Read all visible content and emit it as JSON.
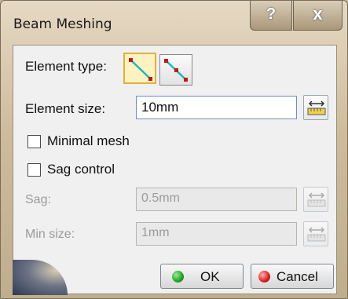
{
  "window": {
    "title": "Beam Meshing",
    "help_glyph": "?",
    "close_glyph": "x"
  },
  "element_type": {
    "label": "Element type:",
    "options": [
      {
        "icon": "linear-beam-element-icon",
        "selected": true
      },
      {
        "icon": "parabolic-beam-element-icon",
        "selected": false
      }
    ]
  },
  "element_size": {
    "label": "Element size:",
    "value": "10mm"
  },
  "minimal_mesh": {
    "label": "Minimal mesh",
    "checked": false
  },
  "sag_control": {
    "label": "Sag control",
    "checked": false
  },
  "sag": {
    "label": "Sag:",
    "value": "0.5mm",
    "enabled": false
  },
  "min_size": {
    "label": "Min size:",
    "value": "1mm",
    "enabled": false
  },
  "buttons": {
    "ok": "OK",
    "cancel": "Cancel"
  },
  "colors": {
    "ok_dot": "#1fa31f",
    "cancel_dot": "#d81e1e",
    "element_line": "#22b7b7",
    "element_node": "#c01818"
  }
}
